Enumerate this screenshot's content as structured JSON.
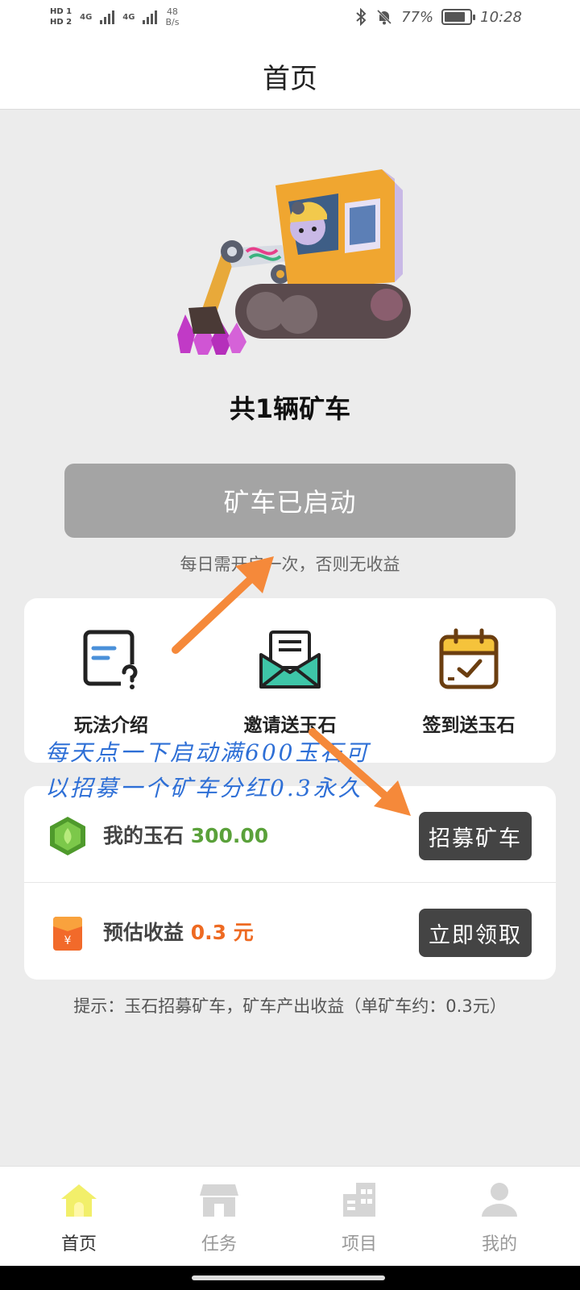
{
  "status_bar": {
    "hd_top": "HD 1",
    "hd_bottom": "HD 2",
    "net1": "4G",
    "net2": "4G",
    "speed_value": "48",
    "speed_unit": "B/s",
    "bluetooth_icon": "bluetooth-icon",
    "mute_icon": "bell-off-icon",
    "battery_percent": "77%",
    "battery_level": 0.77,
    "time": "10:28"
  },
  "header": {
    "title": "首页"
  },
  "hero": {
    "image": "excavator-illustration"
  },
  "main": {
    "cart_count_text": "共1辆矿车",
    "start_button_label": "矿车已启动",
    "daily_hint": "每日需开启一次，否则无收益"
  },
  "features": [
    {
      "label": "玩法介绍",
      "icon": "help-document-icon",
      "color": "#4a90d9"
    },
    {
      "label": "邀请送玉石",
      "icon": "envelope-icon",
      "color": "#3ec6a8"
    },
    {
      "label": "签到送玉石",
      "icon": "calendar-check-icon",
      "color": "#f5c33b"
    }
  ],
  "jade": {
    "label": "我的玉石",
    "value": "300.00",
    "button_label": "招募矿车",
    "icon": "jade-gem-icon"
  },
  "earnings": {
    "label": "预估收益",
    "value": "0.3 元",
    "button_label": "立即领取",
    "icon": "red-envelope-icon"
  },
  "tip": "提示：玉石招募矿车，矿车产出收益（单矿车约：0.3元）",
  "annotation": {
    "line1": "每天点一下启动满600玉石可",
    "line2": "以招募一个矿车分红0.3永久"
  },
  "tabs": [
    {
      "label": "首页",
      "icon": "home-icon",
      "active": true
    },
    {
      "label": "任务",
      "icon": "store-icon",
      "active": false
    },
    {
      "label": "项目",
      "icon": "buildings-icon",
      "active": false
    },
    {
      "label": "我的",
      "icon": "user-icon",
      "active": false
    }
  ],
  "colors": {
    "accent_green": "#5aa13a",
    "accent_orange": "#ee6a22",
    "annotation_blue": "#2e6fd6",
    "arrow_orange": "#f5893a"
  }
}
